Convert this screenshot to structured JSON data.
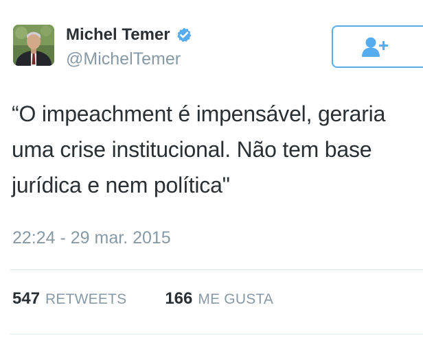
{
  "author": {
    "display_name": "Michel Temer",
    "handle": "@MichelTemer",
    "verified": true,
    "verified_icon": "verified-badge-icon",
    "avatar_icon": "profile-photo"
  },
  "follow_button": {
    "icon": "add-user-icon",
    "color": "#55acee"
  },
  "tweet": {
    "text_lines": [
      "“O impeachment é impensável, geraria",
      "uma crise institucional. Não tem base",
      "jurídica e nem política\""
    ],
    "timestamp": "22:24 - 29 mar. 2015"
  },
  "stats": {
    "retweets_count": "547",
    "retweets_label": "RETWEETS",
    "likes_count": "166",
    "likes_label": "ME GUSTA"
  },
  "colors": {
    "text": "#292f33",
    "muted": "#8899a6",
    "accent": "#55acee",
    "divider": "#e1e8ed"
  }
}
